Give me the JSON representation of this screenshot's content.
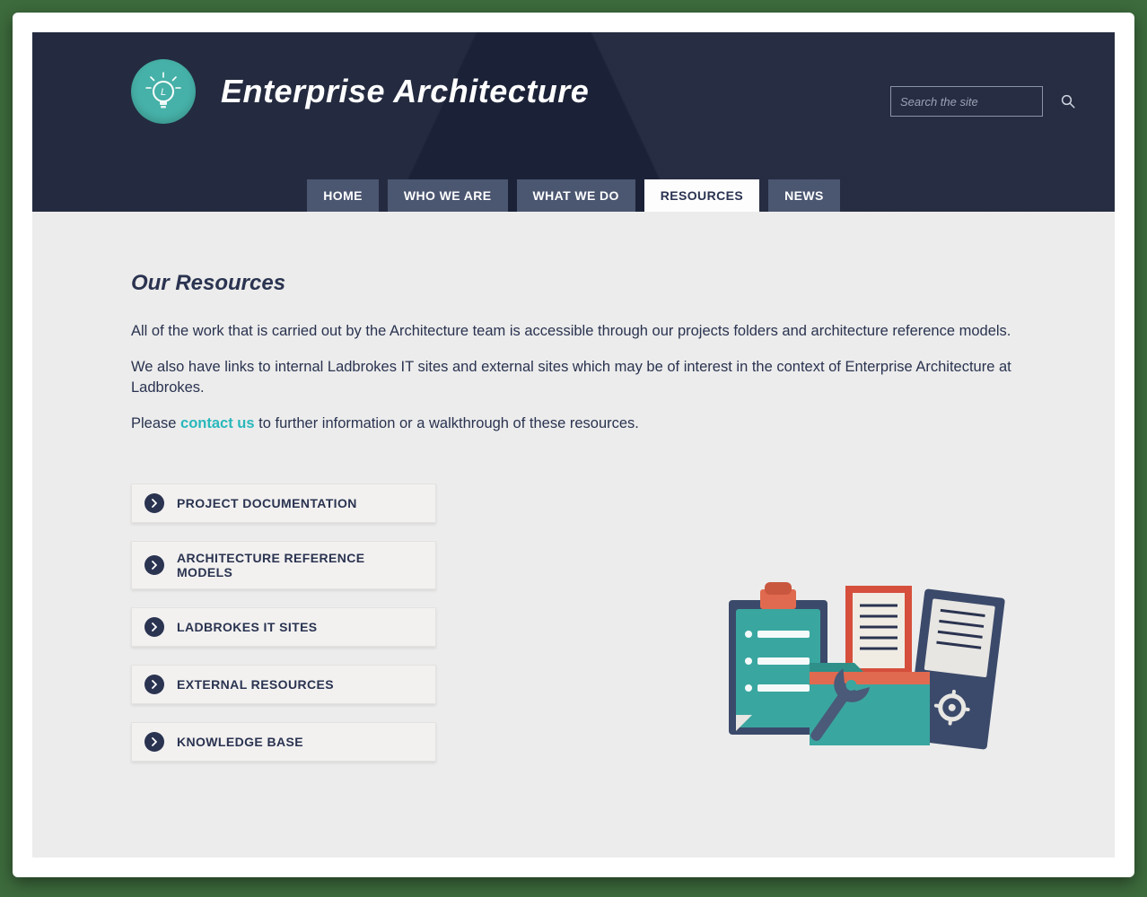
{
  "site": {
    "title": "Enterprise Architecture"
  },
  "search": {
    "placeholder": "Search the site"
  },
  "nav": {
    "items": [
      {
        "label": "HOME",
        "active": false
      },
      {
        "label": "WHO WE ARE",
        "active": false
      },
      {
        "label": "WHAT WE DO",
        "active": false
      },
      {
        "label": "RESOURCES",
        "active": true
      },
      {
        "label": "NEWS",
        "active": false
      }
    ]
  },
  "main": {
    "heading": "Our Resources",
    "para1": "All of the work that is carried out by the Architecture team is accessible through our projects folders and architecture reference models.",
    "para2": "We also have links to internal Ladbrokes IT sites and external sites which may be of interest in the context of Enterprise Architecture at Ladbrokes.",
    "para3_prefix": "Please ",
    "para3_link": "contact us",
    "para3_suffix": " to further information or a walkthrough of these resources."
  },
  "resources": {
    "items": [
      {
        "label": "PROJECT DOCUMENTATION"
      },
      {
        "label": "ARCHITECTURE REFERENCE MODELS"
      },
      {
        "label": "LADBROKES IT SITES"
      },
      {
        "label": "EXTERNAL RESOURCES"
      },
      {
        "label": "KNOWLEDGE BASE"
      }
    ]
  },
  "colors": {
    "header_bg": "#1b2238",
    "accent_teal": "#46b1a8",
    "nav_bg": "#4b5670",
    "text_dark": "#2a3350",
    "link_teal": "#28b8bb"
  }
}
